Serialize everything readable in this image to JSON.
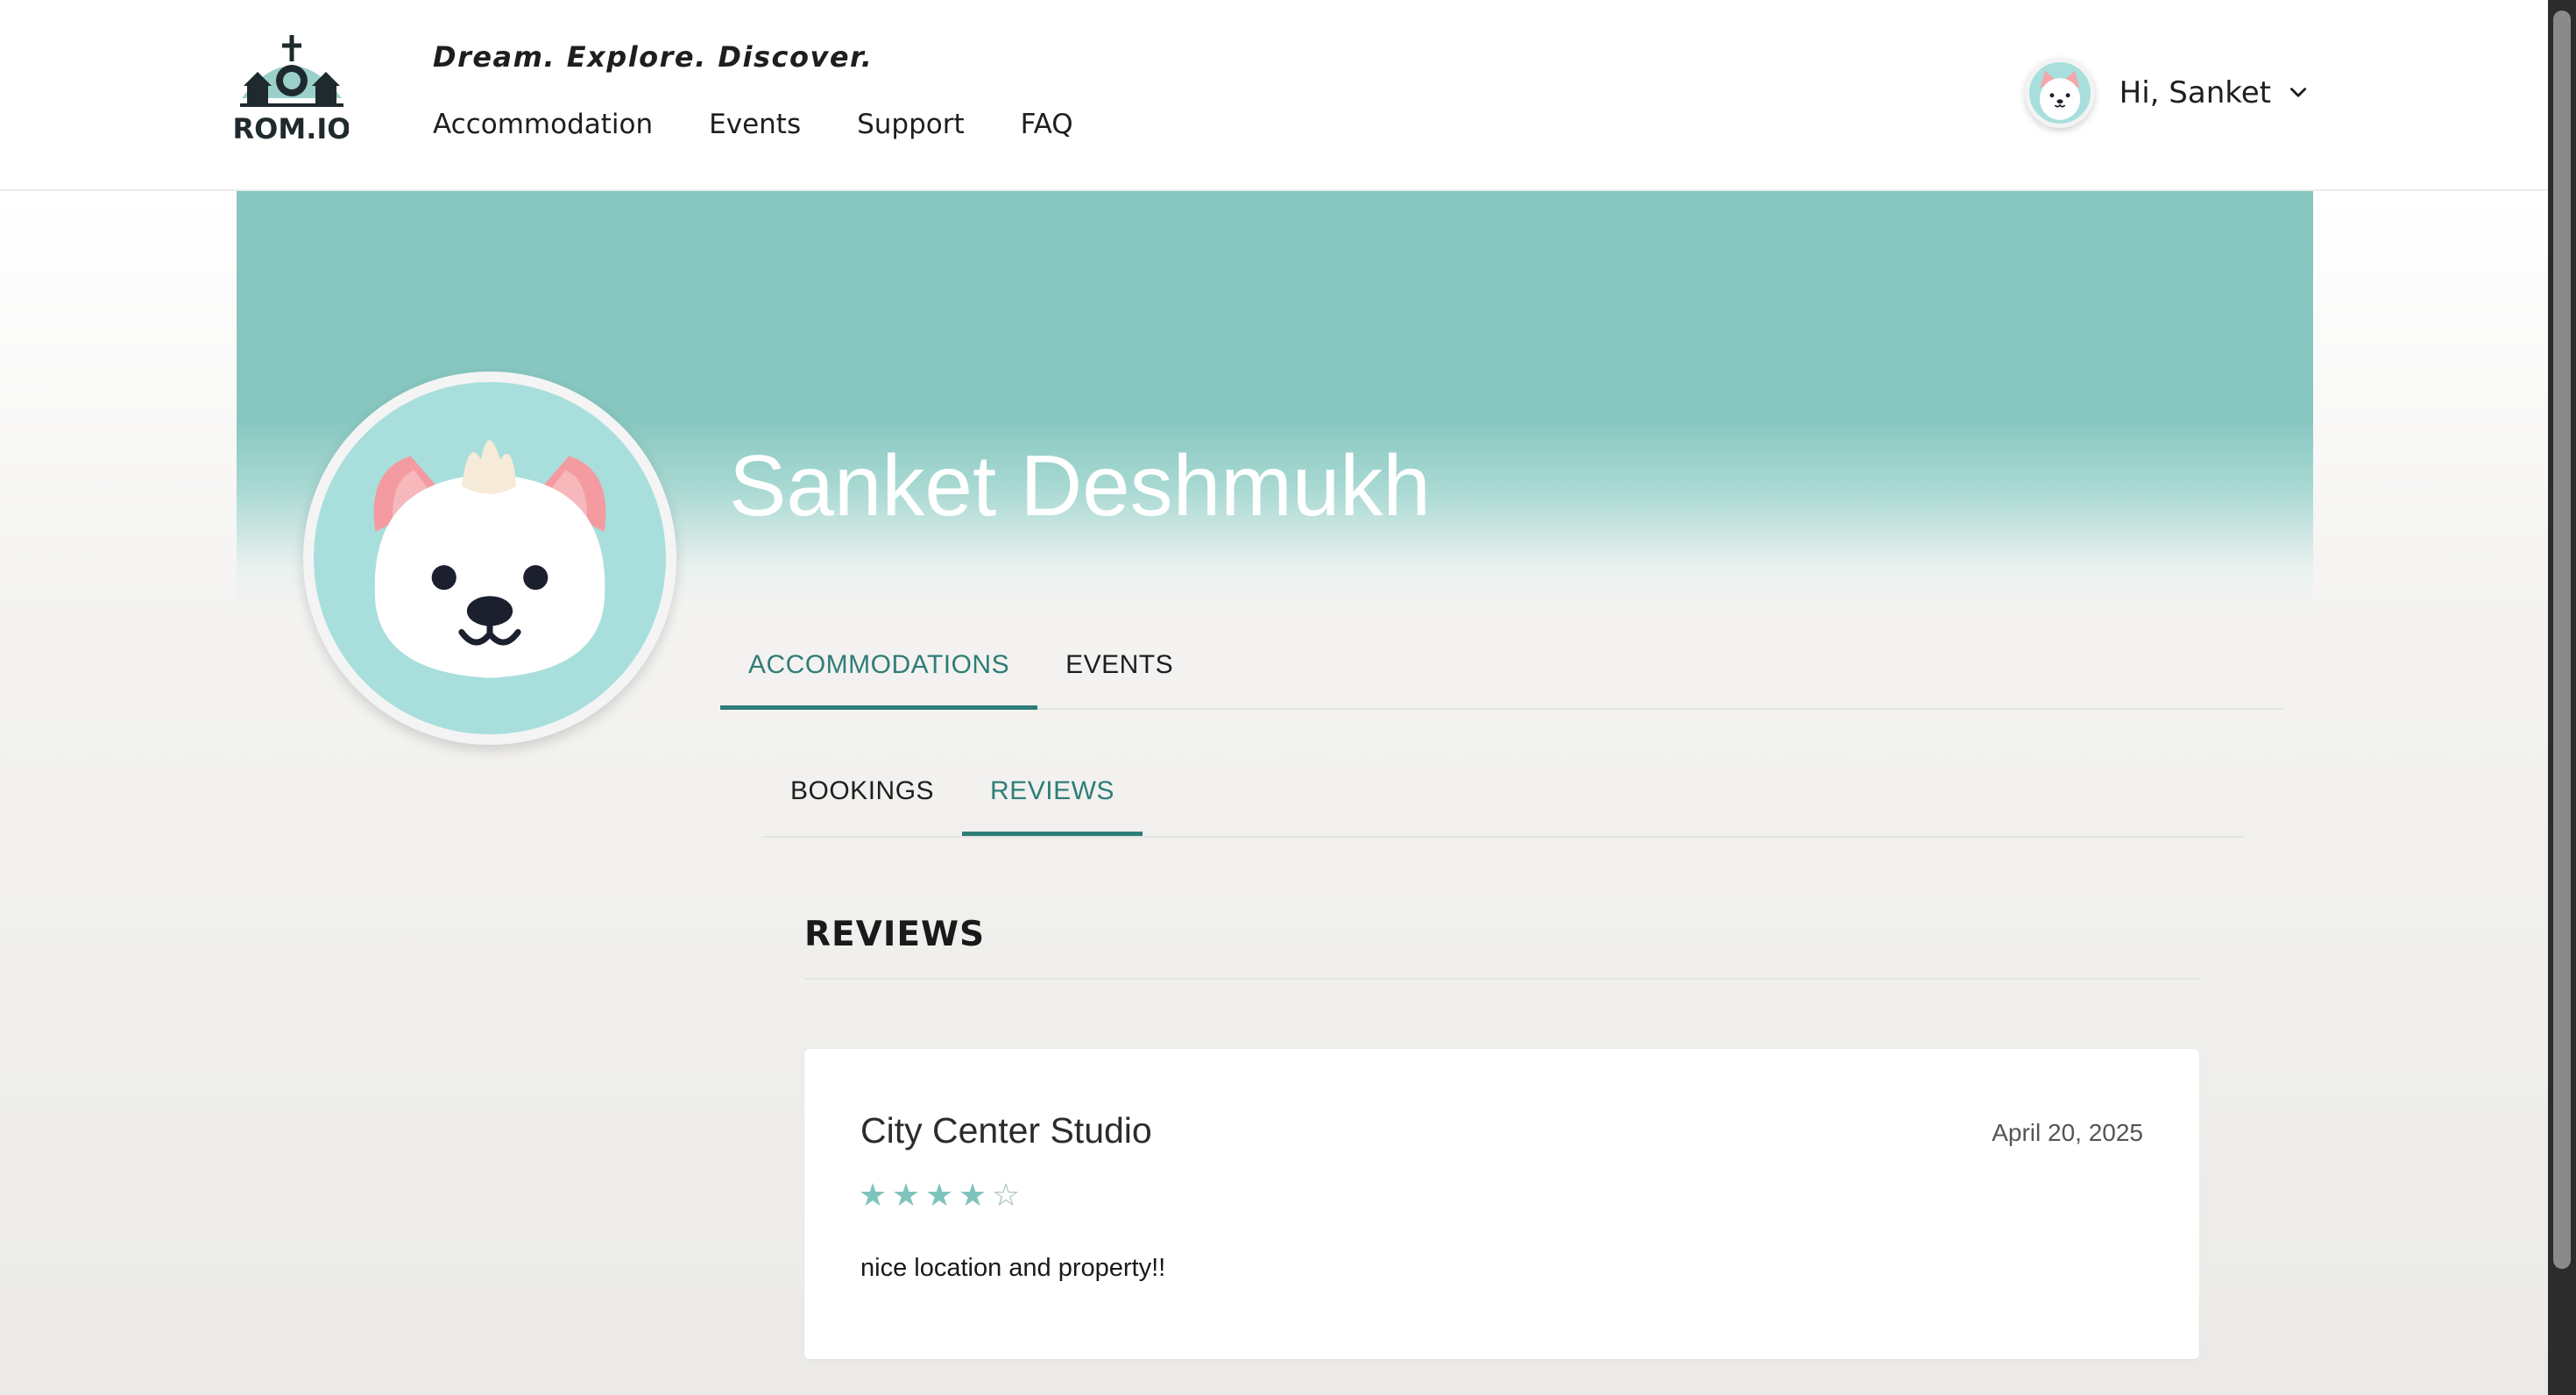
{
  "header": {
    "logo_text": "ROM.IO",
    "tagline": "Dream. Explore. Discover.",
    "nav": [
      "Accommodation",
      "Events",
      "Support",
      "FAQ"
    ],
    "greeting": "Hi, Sanket"
  },
  "profile": {
    "name": "Sanket Deshmukh",
    "avatar_icon": "white-cat-avatar-icon",
    "banner_color": "#87c7c0"
  },
  "tabs": {
    "main": [
      "ACCOMMODATIONS",
      "EVENTS"
    ],
    "main_active": "ACCOMMODATIONS",
    "sub": [
      "BOOKINGS",
      "REVIEWS"
    ],
    "sub_active": "REVIEWS"
  },
  "reviews": {
    "heading": "REVIEWS",
    "items": [
      {
        "title": "City Center Studio",
        "date": "April 20, 2025",
        "rating": 4,
        "max_rating": 5,
        "text": "nice location and property!!"
      }
    ]
  },
  "colors": {
    "accent": "#2e7d78",
    "star": "#7fc3bd",
    "avatar_bg": "#a8dfdc"
  }
}
